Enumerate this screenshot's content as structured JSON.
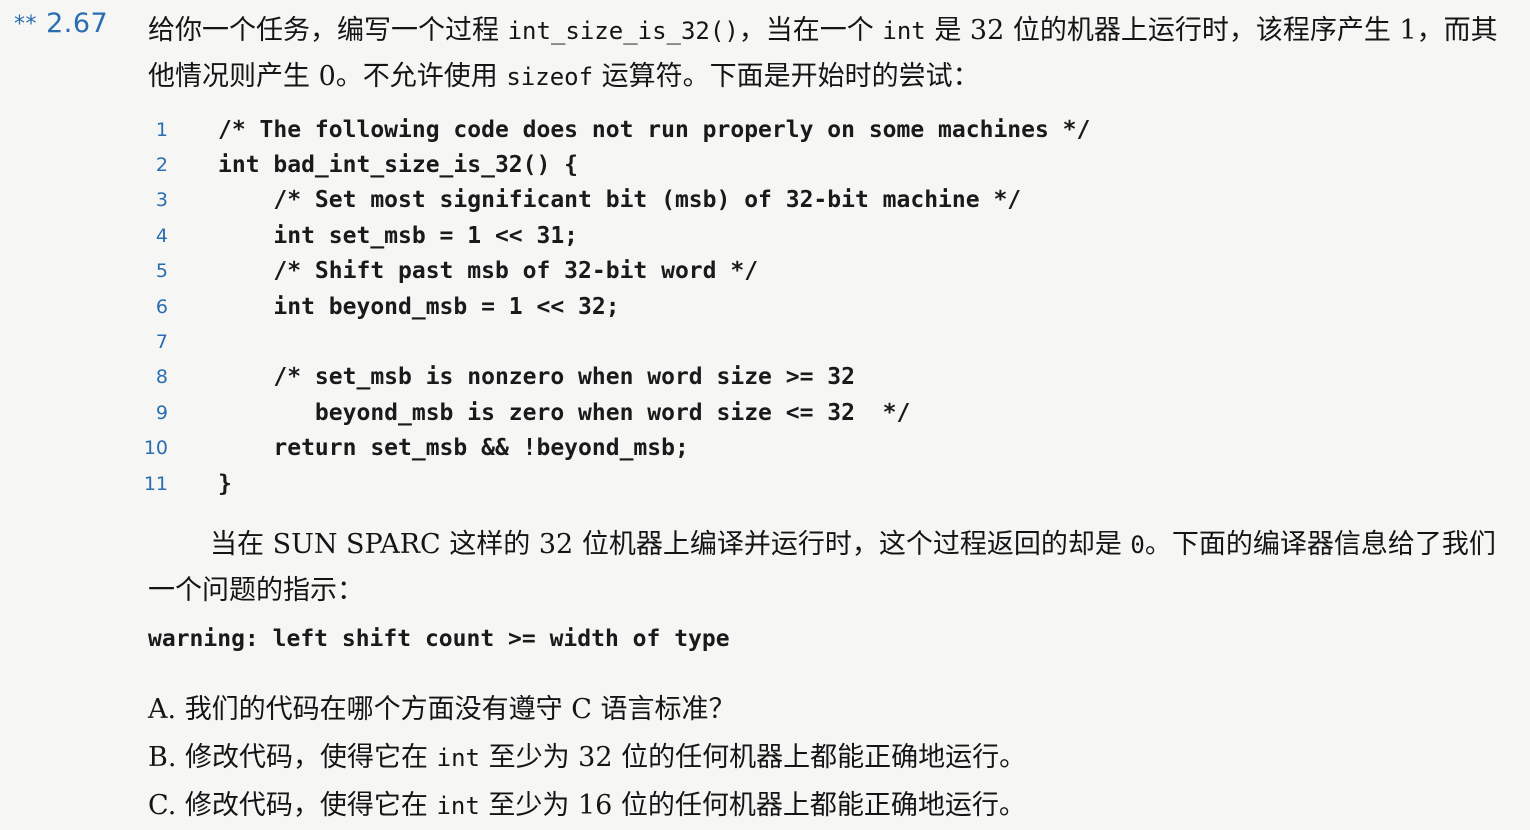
{
  "problem": {
    "stars": "**",
    "number": "2.67",
    "intro_before_code": "给你一个任务，编写一个过程 ",
    "intro_function": "int_size_is_32()",
    "intro_middle": "，当在一个 ",
    "intro_int": "int",
    "intro_after": " 是 32 位的机器上运行时，该程序产生 1，而其他情况则产生 0。不允许使用 ",
    "intro_sizeof": "sizeof",
    "intro_end": " 运算符。下面是开始时的尝试："
  },
  "code_lines": [
    {
      "num": "1",
      "code": "/* The following code does not run properly on some machines */"
    },
    {
      "num": "2",
      "code": "int bad_int_size_is_32() {"
    },
    {
      "num": "3",
      "code": "    /* Set most significant bit (msb) of 32-bit machine */"
    },
    {
      "num": "4",
      "code": "    int set_msb = 1 << 31;"
    },
    {
      "num": "5",
      "code": "    /* Shift past msb of 32-bit word */"
    },
    {
      "num": "6",
      "code": "    int beyond_msb = 1 << 32;"
    },
    {
      "num": "7",
      "code": ""
    },
    {
      "num": "8",
      "code": "    /* set_msb is nonzero when word size >= 32"
    },
    {
      "num": "9",
      "code": "       beyond_msb is zero when word size <= 32  */"
    },
    {
      "num": "10",
      "code": "    return set_msb && !beyond_msb;"
    },
    {
      "num": "11",
      "code": "}"
    }
  ],
  "paragraph": {
    "before": "当在 SUN SPARC 这样的 32 位机器上编译并运行时，这个过程返回的却是 ",
    "zero": "0",
    "after": "。下面的编译器信息给了我们一个问题的指示："
  },
  "warning": "warning: left shift count >= width of type",
  "questions": [
    {
      "label": "A.",
      "before": "我们的代码在哪个方面没有遵守 C 语言标准？",
      "code": "",
      "after": ""
    },
    {
      "label": "B.",
      "before": "修改代码，使得它在 ",
      "code": "int",
      "after": " 至少为 32 位的任何机器上都能正确地运行。"
    },
    {
      "label": "C.",
      "before": "修改代码，使得它在 ",
      "code": "int",
      "after": " 至少为 16 位的任何机器上都能正确地运行。"
    }
  ]
}
